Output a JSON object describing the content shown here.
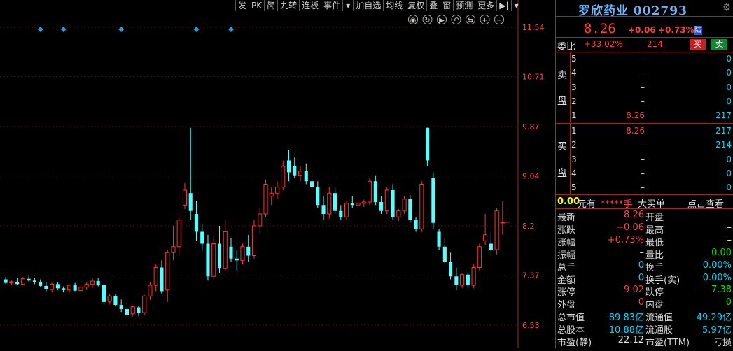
{
  "toolbar": {
    "items": [
      "发",
      "PK",
      "简",
      "九转",
      "连板",
      "事件",
      "▾",
      "加自选",
      "均线",
      "复权",
      "叠",
      "窗",
      "预测",
      "更多",
      "▶|",
      "▾"
    ]
  },
  "chart_data": {
    "type": "candlestick",
    "title": "",
    "yticks": [
      11.54,
      10.71,
      9.87,
      9.04,
      8.2,
      7.37,
      6.53
    ],
    "ylim": [
      6.53,
      11.54
    ],
    "grid": true,
    "colors": {
      "up": "#ff3232",
      "down": "#54ffff",
      "grid": "#5a1010",
      "marker": "#1f9fe0"
    },
    "markers_at_indices": [
      6,
      10,
      20,
      33,
      39
    ],
    "candles": [
      {
        "o": 7.3,
        "h": 7.34,
        "l": 7.22,
        "c": 7.24
      },
      {
        "o": 7.24,
        "h": 7.28,
        "l": 7.2,
        "c": 7.26
      },
      {
        "o": 7.26,
        "h": 7.32,
        "l": 7.21,
        "c": 7.22
      },
      {
        "o": 7.22,
        "h": 7.34,
        "l": 7.2,
        "c": 7.31
      },
      {
        "o": 7.31,
        "h": 7.36,
        "l": 7.25,
        "c": 7.28
      },
      {
        "o": 7.28,
        "h": 7.33,
        "l": 7.22,
        "c": 7.25
      },
      {
        "o": 7.26,
        "h": 7.3,
        "l": 7.18,
        "c": 7.19
      },
      {
        "o": 7.19,
        "h": 7.25,
        "l": 7.1,
        "c": 7.13
      },
      {
        "o": 7.13,
        "h": 7.24,
        "l": 7.08,
        "c": 7.22
      },
      {
        "o": 7.22,
        "h": 7.26,
        "l": 7.12,
        "c": 7.15
      },
      {
        "o": 7.15,
        "h": 7.18,
        "l": 7.08,
        "c": 7.12
      },
      {
        "o": 7.12,
        "h": 7.22,
        "l": 7.07,
        "c": 7.2
      },
      {
        "o": 7.2,
        "h": 7.24,
        "l": 7.1,
        "c": 7.11
      },
      {
        "o": 7.11,
        "h": 7.2,
        "l": 7.08,
        "c": 7.17
      },
      {
        "o": 7.17,
        "h": 7.25,
        "l": 7.12,
        "c": 7.22
      },
      {
        "o": 7.22,
        "h": 7.32,
        "l": 7.15,
        "c": 7.27
      },
      {
        "o": 7.27,
        "h": 7.33,
        "l": 7.18,
        "c": 7.2
      },
      {
        "o": 7.2,
        "h": 7.22,
        "l": 6.88,
        "c": 6.92
      },
      {
        "o": 6.93,
        "h": 7.05,
        "l": 6.88,
        "c": 7.02
      },
      {
        "o": 7.02,
        "h": 7.06,
        "l": 6.85,
        "c": 6.87
      },
      {
        "o": 6.87,
        "h": 6.96,
        "l": 6.75,
        "c": 6.8
      },
      {
        "o": 6.8,
        "h": 6.9,
        "l": 6.64,
        "c": 6.7
      },
      {
        "o": 6.72,
        "h": 6.86,
        "l": 6.68,
        "c": 6.84
      },
      {
        "o": 6.83,
        "h": 6.86,
        "l": 6.68,
        "c": 6.74
      },
      {
        "o": 6.74,
        "h": 7.04,
        "l": 6.7,
        "c": 7.02
      },
      {
        "o": 7.02,
        "h": 7.25,
        "l": 6.96,
        "c": 7.2
      },
      {
        "o": 7.2,
        "h": 7.55,
        "l": 7.1,
        "c": 7.5
      },
      {
        "o": 7.5,
        "h": 7.62,
        "l": 7.06,
        "c": 7.1
      },
      {
        "o": 7.12,
        "h": 7.8,
        "l": 6.92,
        "c": 7.75
      },
      {
        "o": 7.75,
        "h": 8.2,
        "l": 7.62,
        "c": 7.85
      },
      {
        "o": 7.85,
        "h": 8.35,
        "l": 7.7,
        "c": 8.3
      },
      {
        "o": 8.55,
        "h": 8.92,
        "l": 8.48,
        "c": 8.8
      },
      {
        "o": 8.75,
        "h": 9.85,
        "l": 8.3,
        "c": 8.45
      },
      {
        "o": 8.4,
        "h": 8.62,
        "l": 7.95,
        "c": 8.1
      },
      {
        "o": 8.1,
        "h": 8.22,
        "l": 7.8,
        "c": 7.9
      },
      {
        "o": 7.9,
        "h": 8.05,
        "l": 7.28,
        "c": 7.35
      },
      {
        "o": 7.35,
        "h": 8.02,
        "l": 7.3,
        "c": 7.9
      },
      {
        "o": 7.9,
        "h": 8.2,
        "l": 7.4,
        "c": 7.48
      },
      {
        "o": 7.48,
        "h": 8.3,
        "l": 7.45,
        "c": 8.1
      },
      {
        "o": 7.85,
        "h": 8.0,
        "l": 7.6,
        "c": 7.65
      },
      {
        "o": 7.65,
        "h": 7.8,
        "l": 7.45,
        "c": 7.62
      },
      {
        "o": 7.62,
        "h": 7.9,
        "l": 7.55,
        "c": 7.85
      },
      {
        "o": 7.85,
        "h": 8.05,
        "l": 7.6,
        "c": 7.7
      },
      {
        "o": 7.7,
        "h": 8.3,
        "l": 7.65,
        "c": 8.2
      },
      {
        "o": 8.2,
        "h": 8.5,
        "l": 8.08,
        "c": 8.4
      },
      {
        "o": 8.4,
        "h": 8.98,
        "l": 8.35,
        "c": 8.9
      },
      {
        "o": 8.7,
        "h": 8.85,
        "l": 8.55,
        "c": 8.75
      },
      {
        "o": 8.75,
        "h": 8.95,
        "l": 8.65,
        "c": 8.85
      },
      {
        "o": 8.85,
        "h": 9.3,
        "l": 8.8,
        "c": 9.2
      },
      {
        "o": 9.3,
        "h": 9.47,
        "l": 8.95,
        "c": 9.1
      },
      {
        "o": 9.2,
        "h": 9.35,
        "l": 9.0,
        "c": 9.05
      },
      {
        "o": 9.05,
        "h": 9.2,
        "l": 8.95,
        "c": 9.12
      },
      {
        "o": 9.12,
        "h": 9.25,
        "l": 8.9,
        "c": 8.95
      },
      {
        "o": 8.95,
        "h": 9.1,
        "l": 8.65,
        "c": 8.85
      },
      {
        "o": 8.85,
        "h": 8.95,
        "l": 8.5,
        "c": 8.55
      },
      {
        "o": 8.55,
        "h": 8.7,
        "l": 8.3,
        "c": 8.4
      },
      {
        "o": 8.4,
        "h": 8.85,
        "l": 8.32,
        "c": 8.75
      },
      {
        "o": 8.75,
        "h": 8.85,
        "l": 8.4,
        "c": 8.45
      },
      {
        "o": 8.45,
        "h": 8.55,
        "l": 8.3,
        "c": 8.35
      },
      {
        "o": 8.35,
        "h": 8.62,
        "l": 8.3,
        "c": 8.58
      },
      {
        "o": 8.58,
        "h": 8.7,
        "l": 8.5,
        "c": 8.55
      },
      {
        "o": 8.55,
        "h": 8.62,
        "l": 8.5,
        "c": 8.58
      },
      {
        "o": 8.58,
        "h": 8.64,
        "l": 8.52,
        "c": 8.6
      },
      {
        "o": 8.6,
        "h": 9.0,
        "l": 8.55,
        "c": 8.95
      },
      {
        "o": 8.95,
        "h": 9.05,
        "l": 8.55,
        "c": 8.6
      },
      {
        "o": 8.6,
        "h": 8.7,
        "l": 8.4,
        "c": 8.45
      },
      {
        "o": 8.45,
        "h": 8.85,
        "l": 8.4,
        "c": 8.8
      },
      {
        "o": 8.8,
        "h": 8.9,
        "l": 8.3,
        "c": 8.35
      },
      {
        "o": 8.35,
        "h": 8.48,
        "l": 8.28,
        "c": 8.45
      },
      {
        "o": 8.45,
        "h": 8.7,
        "l": 8.4,
        "c": 8.65
      },
      {
        "o": 8.65,
        "h": 8.72,
        "l": 8.25,
        "c": 8.3
      },
      {
        "o": 8.3,
        "h": 8.35,
        "l": 8.1,
        "c": 8.15
      },
      {
        "o": 8.15,
        "h": 8.95,
        "l": 8.1,
        "c": 8.9
      },
      {
        "o": 9.85,
        "h": 9.85,
        "l": 9.2,
        "c": 9.3
      },
      {
        "o": 9.0,
        "h": 9.1,
        "l": 8.15,
        "c": 8.25
      },
      {
        "o": 8.1,
        "h": 8.15,
        "l": 7.8,
        "c": 7.85
      },
      {
        "o": 7.85,
        "h": 8.0,
        "l": 7.55,
        "c": 7.6
      },
      {
        "o": 7.6,
        "h": 7.75,
        "l": 7.3,
        "c": 7.35
      },
      {
        "o": 7.35,
        "h": 7.5,
        "l": 7.12,
        "c": 7.2
      },
      {
        "o": 7.2,
        "h": 7.4,
        "l": 7.15,
        "c": 7.38
      },
      {
        "o": 7.38,
        "h": 7.42,
        "l": 7.15,
        "c": 7.2
      },
      {
        "o": 7.2,
        "h": 7.55,
        "l": 7.15,
        "c": 7.5
      },
      {
        "o": 7.5,
        "h": 7.9,
        "l": 7.45,
        "c": 7.85
      },
      {
        "o": 7.95,
        "h": 8.4,
        "l": 7.88,
        "c": 8.05
      },
      {
        "o": 7.9,
        "h": 8.1,
        "l": 7.7,
        "c": 7.8
      },
      {
        "o": 7.8,
        "h": 8.5,
        "l": 7.72,
        "c": 8.45
      },
      {
        "o": 8.25,
        "h": 8.62,
        "l": 8.05,
        "c": 8.26
      }
    ]
  },
  "quote": {
    "name": "罗欣药业",
    "code": "002793",
    "price": "8.26",
    "change": "+0.06",
    "change_pct": "+0.73%",
    "market": "陆",
    "weibi_label": "委比",
    "weibi_value": "+33.02%",
    "weibi_diff": "214",
    "buy_btn": "买",
    "sell_btn": "卖",
    "sell_side_label": [
      "卖",
      "盘"
    ],
    "buy_side_label": [
      "买",
      "盘"
    ],
    "sell_levels": [
      {
        "n": "5",
        "p": "–",
        "v": "0"
      },
      {
        "n": "4",
        "p": "–",
        "v": "0"
      },
      {
        "n": "3",
        "p": "–",
        "v": "0"
      },
      {
        "n": "2",
        "p": "–",
        "v": "0"
      },
      {
        "n": "1",
        "p": "8.26",
        "v": "217"
      }
    ],
    "buy_levels": [
      {
        "n": "1",
        "p": "8.26",
        "v": "217"
      },
      {
        "n": "2",
        "p": "–",
        "v": "214"
      },
      {
        "n": "3",
        "p": "–",
        "v": "0"
      },
      {
        "n": "4",
        "p": "–",
        "v": "0"
      },
      {
        "n": "5",
        "p": "–",
        "v": "0"
      }
    ],
    "big_order": {
      "amount": "0.00",
      "unit": "元有",
      "hand": "*****手",
      "label": "大买单",
      "link": "点击查看"
    },
    "stats_left": [
      {
        "k": "最新",
        "v": "8.26",
        "c": "red"
      },
      {
        "k": "涨跌",
        "v": "+0.06",
        "c": "red"
      },
      {
        "k": "涨幅",
        "v": "+0.73%",
        "c": "red"
      },
      {
        "k": "振幅",
        "v": "–",
        "c": "white"
      },
      {
        "k": "总手",
        "v": "0",
        "c": "cyan"
      },
      {
        "k": "金额",
        "v": "0",
        "c": "cyan"
      },
      {
        "k": "涨停",
        "v": "9.02",
        "c": "red"
      },
      {
        "k": "外盘",
        "v": "0",
        "c": "red"
      },
      {
        "k": "总市值",
        "v": "89.83亿",
        "c": "cyan"
      },
      {
        "k": "总股本",
        "v": "10.88亿",
        "c": "cyan"
      },
      {
        "k": "市盈(静)",
        "v": "22.12",
        "c": "white"
      }
    ],
    "stats_right": [
      {
        "k": "开盘",
        "v": "–",
        "c": "white"
      },
      {
        "k": "最高",
        "v": "–",
        "c": "white"
      },
      {
        "k": "最低",
        "v": "–",
        "c": "white"
      },
      {
        "k": "量比",
        "v": "0.00",
        "c": "green"
      },
      {
        "k": "换手",
        "v": "0.00%",
        "c": "cyan"
      },
      {
        "k": "换手(实)",
        "v": "0.00%",
        "c": "cyan"
      },
      {
        "k": "跌停",
        "v": "7.38",
        "c": "green"
      },
      {
        "k": "内盘",
        "v": "0",
        "c": "green"
      },
      {
        "k": "流通值",
        "v": "49.29亿",
        "c": "cyan"
      },
      {
        "k": "流通股",
        "v": "5.97亿",
        "c": "cyan"
      },
      {
        "k": "市盈(TTM)",
        "v": "亏损",
        "c": "white"
      }
    ]
  }
}
